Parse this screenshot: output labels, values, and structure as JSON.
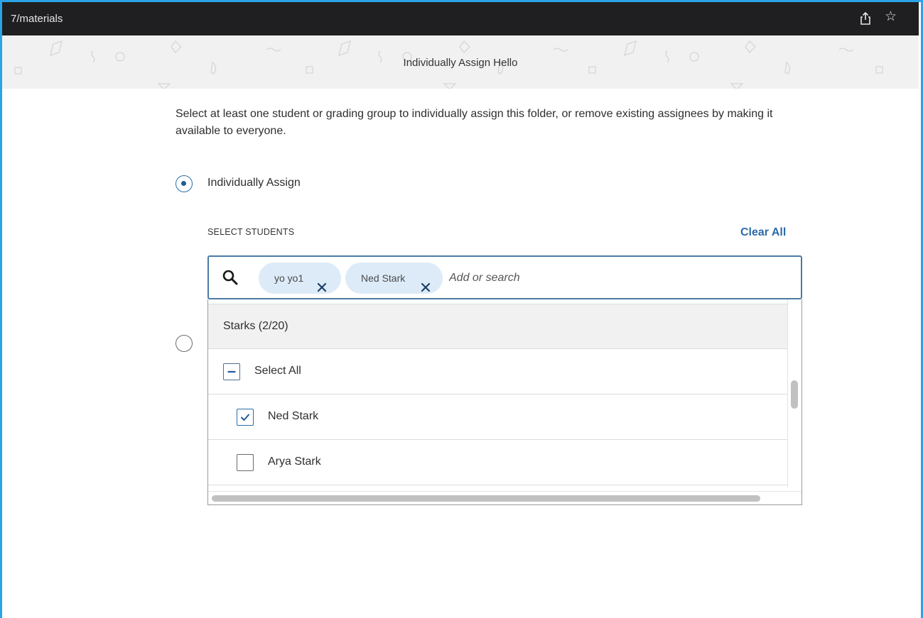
{
  "browser": {
    "url_fragment": "7/materials",
    "share_icon": "share-icon",
    "bookmark_icon": "star-icon"
  },
  "header": {
    "title": "Individually Assign Hello"
  },
  "description": "Select at least one student or grading group to individually assign this folder, or remove existing assignees by making it available to everyone.",
  "options": {
    "individually_assign": {
      "label": "Individually Assign",
      "selected": true
    },
    "second_option": {
      "selected": false
    }
  },
  "select_students": {
    "label": "SELECT STUDENTS",
    "clear_all": "Clear All",
    "search_placeholder": "Add or search",
    "chips": [
      {
        "label": "yo yo1"
      },
      {
        "label": "Ned Stark"
      }
    ]
  },
  "dropdown": {
    "group": {
      "label": "Starks (2/20)"
    },
    "select_all": {
      "label": "Select All",
      "state": "indeterminate"
    },
    "students": [
      {
        "name": "Ned Stark",
        "checked": true
      },
      {
        "name": "Arya Stark",
        "checked": false
      }
    ]
  },
  "colors": {
    "accent": "#2c6aa8",
    "chip_bg": "#dcebf7",
    "frame": "#2ba3e6"
  }
}
